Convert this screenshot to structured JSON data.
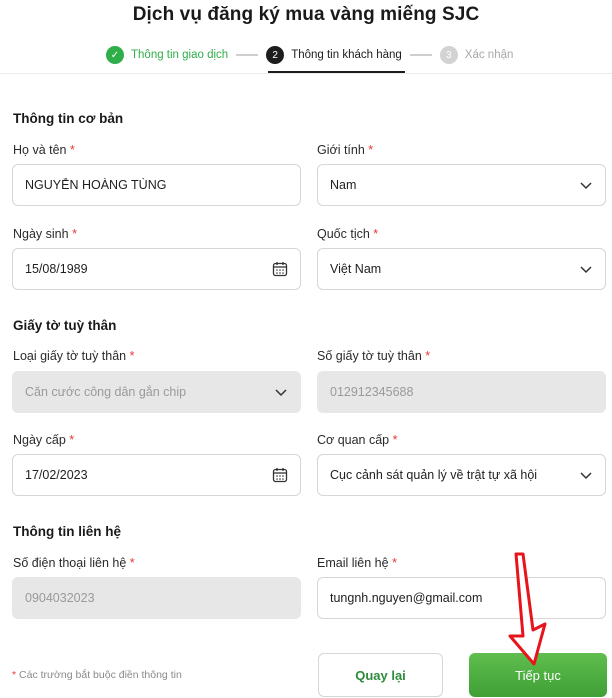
{
  "page": {
    "title": "Dịch vụ đăng ký mua vàng miếng SJC"
  },
  "stepper": {
    "steps": [
      {
        "number": "✓",
        "label": "Thông tin giao dịch",
        "status": "done"
      },
      {
        "number": "2",
        "label": "Thông tin khách hàng",
        "status": "active"
      },
      {
        "number": "3",
        "label": "Xác nhận",
        "status": "pending"
      }
    ]
  },
  "sections": {
    "basic": "Thông tin cơ bản",
    "id_docs": "Giấy tờ tuỳ thân",
    "contact": "Thông tin liên hệ"
  },
  "required_mark": "*",
  "fields": {
    "full_name": {
      "label": "Họ và tên",
      "value": "NGUYỄN HOÀNG TÙNG"
    },
    "gender": {
      "label": "Giới tính",
      "value": "Nam"
    },
    "dob": {
      "label": "Ngày sinh",
      "value": "15/08/1989"
    },
    "nationality": {
      "label": "Quốc tịch",
      "value": "Việt Nam"
    },
    "id_type": {
      "label": "Loại giấy tờ tuỳ thân",
      "value": "Căn cước công dân gắn chip"
    },
    "id_number": {
      "label": "Số giấy tờ tuỳ thân",
      "value": "012912345688"
    },
    "issue_date": {
      "label": "Ngày cấp",
      "value": "17/02/2023"
    },
    "issuer": {
      "label": "Cơ quan cấp",
      "value": "Cục cảnh sát quản lý về trật tự xã hội"
    },
    "phone": {
      "label": "Số điện thoại liên hệ",
      "value": "0904032023"
    },
    "email": {
      "label": "Email liên hệ",
      "value": "tungnh.nguyen@gmail.com"
    }
  },
  "footer": {
    "note": "Các trường bắt buộc điền thông tin",
    "back_label": "Quay lại",
    "next_label": "Tiếp tục"
  },
  "colors": {
    "accent_green": "#2fae4a",
    "required_red": "#e53935",
    "annotation_red": "#e8141b"
  }
}
